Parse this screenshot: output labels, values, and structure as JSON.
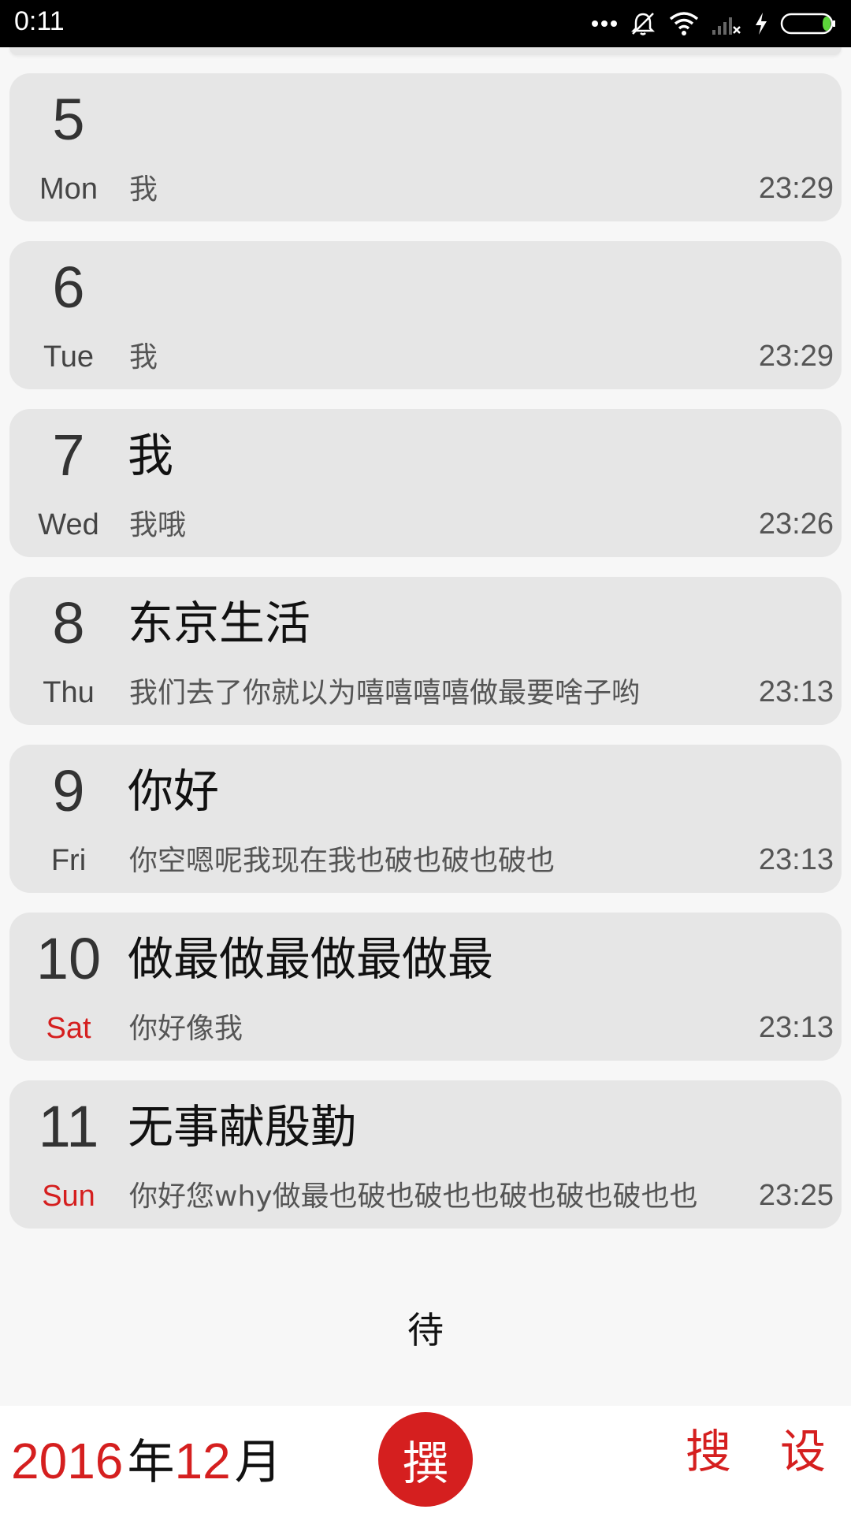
{
  "status_bar": {
    "time": "0:11",
    "icons": [
      "more-dots-icon",
      "vibrate-silent-icon",
      "wifi-icon",
      "signal-no-service-icon",
      "charging-icon",
      "battery-icon"
    ]
  },
  "entries": [
    {
      "day": "5",
      "weekday": "Mon",
      "title": "",
      "preview": "我",
      "time": "23:29",
      "weekend": false
    },
    {
      "day": "6",
      "weekday": "Tue",
      "title": "",
      "preview": "我",
      "time": "23:29",
      "weekend": false
    },
    {
      "day": "7",
      "weekday": "Wed",
      "title": "我",
      "preview": "我哦",
      "time": "23:26",
      "weekend": false
    },
    {
      "day": "8",
      "weekday": "Thu",
      "title": "东京生活",
      "preview": "我们去了你就以为嘻嘻嘻嘻做最要啥子哟",
      "time": "23:13",
      "weekend": false
    },
    {
      "day": "9",
      "weekday": "Fri",
      "title": "你好",
      "preview": "你空嗯呢我现在我也破也破也破也",
      "time": "23:13",
      "weekend": false
    },
    {
      "day": "10",
      "weekday": "Sat",
      "title": "做最做最做最做最",
      "preview": "你好像我",
      "time": "23:13",
      "weekend": true
    },
    {
      "day": "11",
      "weekday": "Sun",
      "title": "无事献殷勤",
      "preview": "你好您why做最也破也破也也破也破也破也也",
      "time": "23:25",
      "weekend": true
    }
  ],
  "pending_label": "待",
  "bottom_bar": {
    "year": "2016",
    "year_unit": "年",
    "month": "12",
    "month_unit": "月",
    "compose_label": "撰",
    "search_label": "搜",
    "settings_label": "设"
  },
  "colors": {
    "accent": "#d51f1f",
    "card_bg": "#e6e6e6",
    "page_bg": "#f7f7f7"
  }
}
